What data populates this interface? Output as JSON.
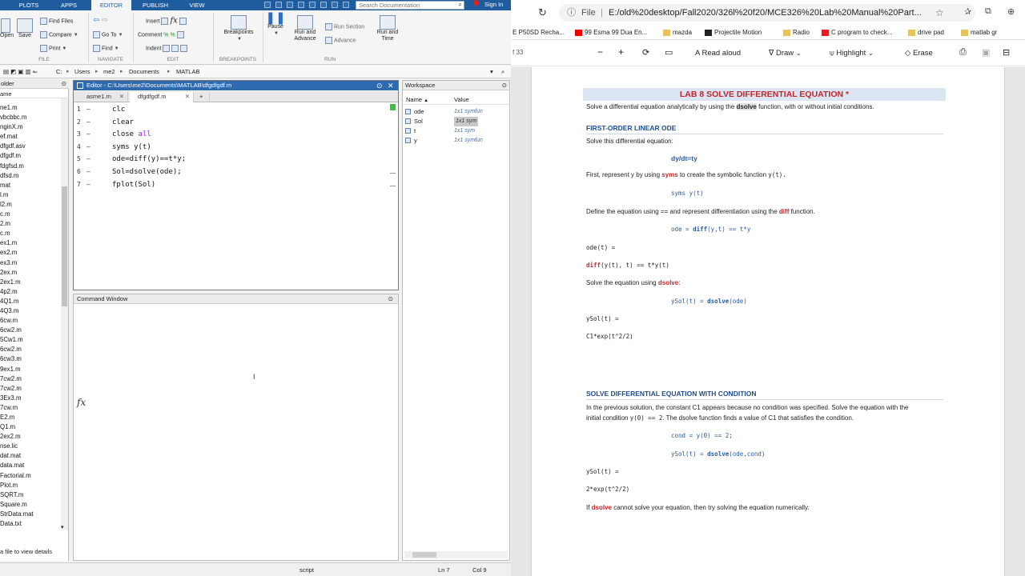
{
  "matlab": {
    "tabs": [
      "PLOTS",
      "APPS",
      "EDITOR",
      "PUBLISH",
      "VIEW"
    ],
    "search_placeholder": "Search Documentation",
    "sign_in": "Sign In",
    "ribbon": {
      "file": {
        "open": "Open",
        "save": "Save",
        "find_files": "Find Files",
        "compare": "Compare",
        "print": "Print",
        "label": "FILE"
      },
      "navigate": {
        "goto": "Go To",
        "find": "Find",
        "label": "NAVIGATE"
      },
      "edit": {
        "insert": "Insert",
        "comment": "Comment",
        "indent": "Indent",
        "fx": "fx",
        "label": "EDIT"
      },
      "breakpoints": {
        "breakpoints": "Breakpoints",
        "label": "BREAKPOINTS"
      },
      "run": {
        "pause": "Pause",
        "run_advance": "Run and Advance",
        "run_section": "Run Section",
        "advance": "Advance",
        "run_time": "Run and Time",
        "label": "RUN"
      }
    },
    "address": [
      "C:",
      "Users",
      "me2",
      "Documents",
      "MATLAB"
    ],
    "file_browser": {
      "title": "older",
      "col_name": "ame",
      "files": [
        "ne1.m",
        "vbcbbc.m",
        "nginX.m",
        "ef.mat",
        "dfgdf.asv",
        "dfgdf.m",
        "fdgfsd.m",
        "dfsd.m",
        "mat",
        "l.m",
        "l2.m",
        "c.m",
        "2.m",
        "c.m",
        "ex1.m",
        "ex2.m",
        "ex3.m",
        "2ex.m",
        "2ex1.m",
        "4p2.m",
        "4Q1.m",
        "4Q3.m",
        "6cw.m",
        "6cw2.m",
        "5Cw1.m",
        "6cw2.m",
        "6cw3.m",
        "9ex1.m",
        "7cw2.m",
        "7cw2.m",
        "3Ex3.m",
        "7cw.m",
        "E2.m",
        "Q1.m",
        "2ex2.m",
        "nse.lic",
        "dat.mat",
        "data.mat",
        "Factorial.m",
        "Plot.m",
        "SQRT.m",
        "Square.m",
        "StrData.mat",
        "Data.txt"
      ],
      "details": "a file to view details"
    },
    "editor": {
      "title": "Editor - C:\\Users\\me2\\Documents\\MATLAB\\dfgdfgdf.m",
      "tabs": [
        "asme1.m",
        "dfgdfgdf.m"
      ],
      "lines": [
        {
          "n": "1",
          "code": "clc"
        },
        {
          "n": "2",
          "code": "clear"
        },
        {
          "n": "3",
          "code": "close",
          "kw": "all"
        },
        {
          "n": "4",
          "code": "syms y(t)"
        },
        {
          "n": "5",
          "code": "ode=diff(y)==t*y;"
        },
        {
          "n": "6",
          "code": "Sol=dsolve(ode);"
        },
        {
          "n": "7",
          "code": "fplot(Sol)"
        }
      ]
    },
    "command_window": {
      "title": "Command Window",
      "prompt": "fx"
    },
    "workspace": {
      "title": "Workspace",
      "col_name": "Name",
      "col_value": "Value",
      "vars": [
        {
          "name": "ode",
          "value": "1x1 symfun"
        },
        {
          "name": "Sol",
          "value": "1x1 sym"
        },
        {
          "name": "t",
          "value": "1x1 sym"
        },
        {
          "name": "y",
          "value": "1x1 symfun"
        }
      ]
    },
    "status": {
      "mode": "script",
      "ln": "Ln  7",
      "col": "Col  9"
    }
  },
  "browser": {
    "url_scheme": "File",
    "url": "E:/old%20desktop/Fall2020/326l%20f20/MCE326%20Lab%20Manual%20Part...",
    "bookmarks": [
      "E P50SD Recha...",
      "99 Esma 99 Dua En...",
      "mazda",
      "Projectile Motion",
      "Radio",
      "C program to check...",
      "drive pad",
      "matlab gr"
    ],
    "pdf_toolbar": {
      "page": "f 33",
      "read_aloud": "Read aloud",
      "draw": "Draw",
      "highlight": "Highlight",
      "erase": "Erase"
    },
    "doc": {
      "title": "LAB 8 SOLVE DIFFERENTIAL EQUATION",
      "title_star": "*",
      "intro_a": "Solve a differential equation analytically by using the ",
      "intro_fn": "dsolve",
      "intro_b": " function, with or without initial conditions.",
      "h1": "FIRST-ORDER LINEAR ODE",
      "p1": "Solve this differential equation:",
      "eq1": "dy/dt=ty",
      "p2a": "First, represent y by using ",
      "p2fn": "syms",
      "p2b": " to create the symbolic function ",
      "p2c": "y(t).",
      "code1": "syms y(t)",
      "p3a": "Define the equation using == and represent differentiation using the ",
      "p3fn": "diff",
      "p3b": " function.",
      "code2a": "ode = ",
      "code2fn": "diff",
      "code2b": "(y,t) == t*y",
      "out1": "ode(t) =",
      "out2fn": "diff",
      "out2": "(y(t), t) == t*y(t)",
      "p4a": "Solve the equation using ",
      "p4fn": "dsolve",
      "p4b": ":",
      "code3a": "ySol(t) = ",
      "code3fn": "dsolve",
      "code3b": "(ode)",
      "out3": "ySol(t) =",
      "out4": "C1*exp(t^2/2)",
      "h2": "SOLVE DIFFERENTIAL EQUATION WITH CONDITION",
      "p5": "In the previous solution, the constant C1 appears because no condition was specified. Solve the equation with the",
      "p6a": "initial condition ",
      "p6code": "y(0) == 2",
      "p6b": ". The dsolve function finds a value of C1 that satisfies the condition.",
      "code4": "cond = y(0) == 2;",
      "code5a": "ySol(t) = ",
      "code5fn": "dsolve",
      "code5b": "(ode,cond)",
      "out5": "ySol(t) =",
      "out6": "2*exp(t^2/2)",
      "p7a": "If ",
      "p7fn": "dsolve",
      "p7b": " cannot solve your equation, then try solving the equation numerically."
    }
  }
}
